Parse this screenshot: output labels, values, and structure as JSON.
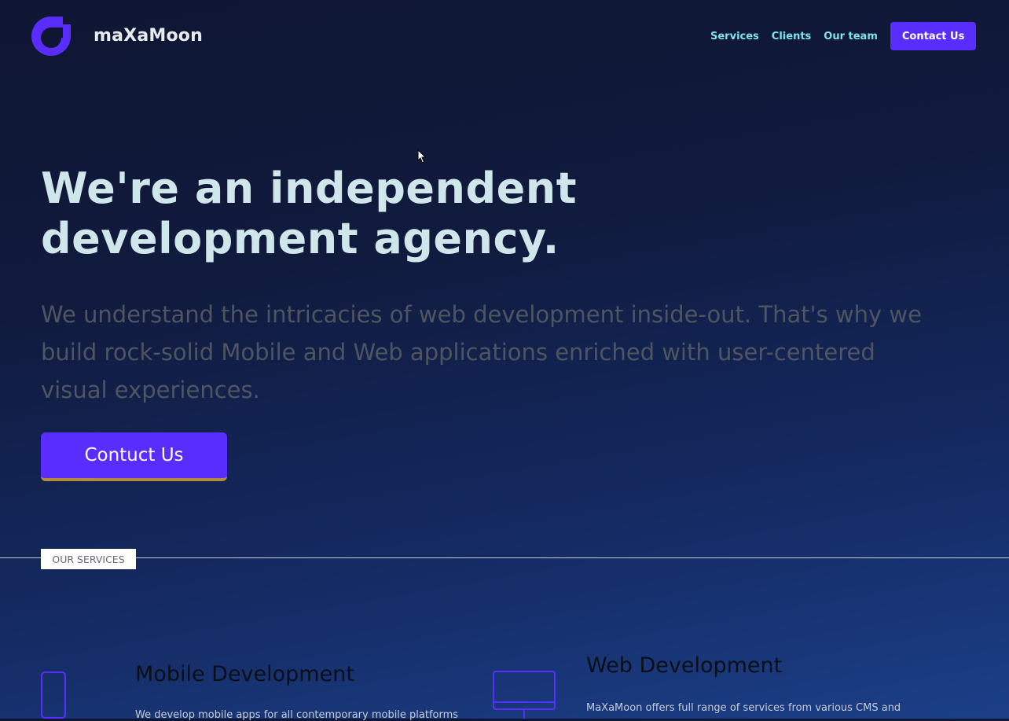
{
  "header": {
    "brand": "maXaMoon",
    "nav": {
      "services": "Services",
      "clients": "Clients",
      "team": "Our team",
      "contact": "Contact Us"
    }
  },
  "hero": {
    "title": "We're an independent development agency.",
    "lead": "We understand the intricacies of web development inside-out. That's why we build rock-solid Mobile and Web applications enriched with user-centered visual experiences.",
    "cta": "Contuct Us"
  },
  "services": {
    "section_label": "OUR SERVICES",
    "items": [
      {
        "title": "Mobile Development",
        "text": "We develop mobile apps for all contemporary mobile platforms",
        "icon": "phone-icon"
      },
      {
        "title": "Web Development",
        "text": "MaXaMoon offers full range of services from various CMS and",
        "icon": "monitor-icon"
      }
    ]
  },
  "colors": {
    "accent": "#5a2dff",
    "nav_link": "#7fe3ea",
    "heading": "#cfe6ea",
    "cta_underline": "#b38a3a"
  }
}
